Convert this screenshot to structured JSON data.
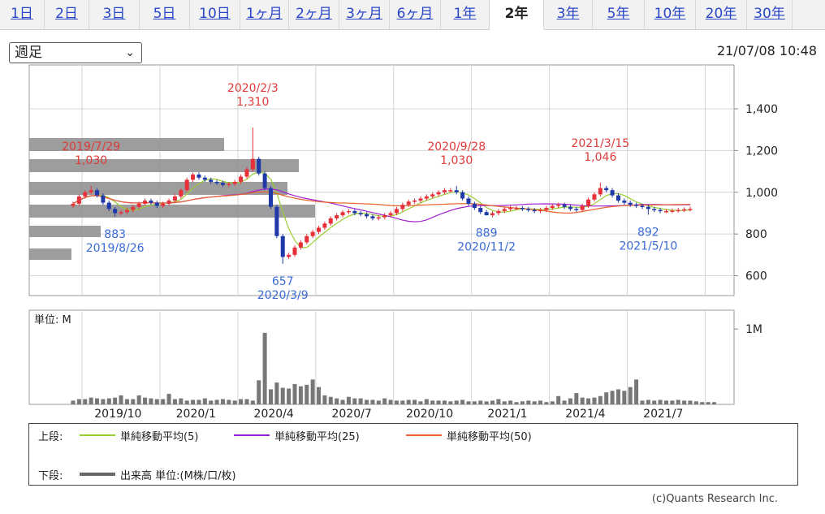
{
  "tabs": [
    {
      "label": "1日",
      "active": false
    },
    {
      "label": "2日",
      "active": false
    },
    {
      "label": "3日",
      "active": false
    },
    {
      "label": "5日",
      "active": false
    },
    {
      "label": "10日",
      "active": false
    },
    {
      "label": "1ヶ月",
      "active": false
    },
    {
      "label": "2ヶ月",
      "active": false
    },
    {
      "label": "3ヶ月",
      "active": false
    },
    {
      "label": "6ヶ月",
      "active": false
    },
    {
      "label": "1年",
      "active": false
    },
    {
      "label": "2年",
      "active": true
    },
    {
      "label": "3年",
      "active": false
    },
    {
      "label": "5年",
      "active": false
    },
    {
      "label": "10年",
      "active": false
    },
    {
      "label": "20年",
      "active": false
    },
    {
      "label": "30年",
      "active": false
    }
  ],
  "period_select": {
    "value": "週足"
  },
  "timestamp": "21/07/08 10:48",
  "chart_data": {
    "type": "candlestick",
    "price_axis": {
      "ticks": [
        600,
        800,
        1000,
        1200,
        1400
      ],
      "tick_labels": [
        "600",
        "800",
        "1,000",
        "1,200",
        "1,400"
      ],
      "ylim": [
        505,
        1610
      ]
    },
    "volume_axis": {
      "unit_label": "単位: M",
      "ticks": [
        1
      ],
      "tick_labels": [
        "1M"
      ],
      "ylim": [
        0,
        1.25
      ]
    },
    "x_ticks": [
      "2019/10",
      "2020/1",
      "2020/4",
      "2020/7",
      "2020/10",
      "2021/1",
      "2021/4",
      "2021/7"
    ],
    "annotations": [
      {
        "date": "2020/2/3",
        "value_label": "1,310",
        "kind": "high",
        "date_label": "2020/2/3",
        "value": 1310,
        "week": 30
      },
      {
        "date": "2019/7/29",
        "value_label": "1,030",
        "kind": "high",
        "date_label": "2019/7/29",
        "value": 1030,
        "week": 3
      },
      {
        "date": "2020/9/28",
        "value_label": "1,030",
        "kind": "high",
        "date_label": "2020/9/28",
        "value": 1030,
        "week": 64
      },
      {
        "date": "2021/3/15",
        "value_label": "1,046",
        "kind": "high",
        "date_label": "2021/3/15",
        "value": 1046,
        "week": 88
      },
      {
        "date": "2019/8/26",
        "value_label": "883",
        "kind": "low",
        "date_label": "2019/8/26",
        "value": 883,
        "week": 7
      },
      {
        "date": "2020/3/9",
        "value_label": "657",
        "kind": "low",
        "date_label": "2020/3/9",
        "value": 657,
        "week": 35
      },
      {
        "date": "2020/11/2",
        "value_label": "889",
        "kind": "low",
        "date_label": "2020/11/2",
        "value": 889,
        "week": 69
      },
      {
        "date": "2021/5/10",
        "value_label": "892",
        "kind": "low",
        "date_label": "2021/5/10",
        "value": 892,
        "week": 96
      }
    ],
    "volume_profile": [
      0.07,
      0.17,
      0.11,
      0.05
    ],
    "weeks": {
      "close": [
        945,
        980,
        1000,
        1010,
        985,
        950,
        920,
        900,
        905,
        915,
        930,
        945,
        960,
        950,
        935,
        945,
        960,
        980,
        1010,
        1060,
        1085,
        1070,
        1060,
        1050,
        1045,
        1035,
        1040,
        1050,
        1075,
        1110,
        1160,
        1090,
        1020,
        930,
        790,
        690,
        700,
        735,
        760,
        790,
        810,
        830,
        850,
        875,
        890,
        905,
        910,
        900,
        895,
        885,
        875,
        880,
        890,
        900,
        920,
        940,
        955,
        960,
        970,
        980,
        990,
        1000,
        1010,
        1010,
        1000,
        970,
        945,
        925,
        905,
        890,
        900,
        910,
        920,
        925,
        925,
        920,
        915,
        910,
        915,
        925,
        935,
        940,
        930,
        920,
        915,
        935,
        965,
        990,
        1020,
        1010,
        985,
        960,
        950,
        940,
        935,
        930,
        920,
        915,
        910,
        910,
        912,
        915,
        918,
        920
      ],
      "volume": [
        0.05,
        0.07,
        0.07,
        0.09,
        0.08,
        0.07,
        0.08,
        0.09,
        0.12,
        0.07,
        0.07,
        0.12,
        0.09,
        0.08,
        0.07,
        0.07,
        0.14,
        0.07,
        0.08,
        0.05,
        0.06,
        0.06,
        0.08,
        0.05,
        0.06,
        0.07,
        0.06,
        0.05,
        0.07,
        0.07,
        0.05,
        0.32,
        0.95,
        0.2,
        0.29,
        0.22,
        0.21,
        0.27,
        0.24,
        0.26,
        0.33,
        0.23,
        0.12,
        0.1,
        0.08,
        0.06,
        0.1,
        0.08,
        0.08,
        0.06,
        0.06,
        0.05,
        0.08,
        0.06,
        0.05,
        0.05,
        0.06,
        0.06,
        0.04,
        0.07,
        0.05,
        0.05,
        0.05,
        0.04,
        0.05,
        0.06,
        0.04,
        0.04,
        0.05,
        0.04,
        0.05,
        0.07,
        0.04,
        0.05,
        0.03,
        0.04,
        0.05,
        0.04,
        0.05,
        0.03,
        0.04,
        0.11,
        0.05,
        0.08,
        0.15,
        0.09,
        0.08,
        0.09,
        0.11,
        0.16,
        0.18,
        0.2,
        0.18,
        0.23,
        0.33,
        0.05,
        0.06,
        0.05,
        0.06,
        0.05,
        0.05,
        0.06,
        0.05,
        0.05,
        0.04,
        0.03,
        0.03,
        0.03
      ]
    }
  },
  "legend": {
    "upper_label": "上段:",
    "lower_label": "下段:",
    "items": [
      {
        "label": "単純移動平均(5)",
        "color": "#9acd32"
      },
      {
        "label": "単純移動平均(25)",
        "color": "#a020d0"
      },
      {
        "label": "単純移動平均(50)",
        "color": "#e8602a"
      }
    ],
    "volume_label": "出来高 単位:(M株/口/枚)",
    "volume_color": "#666666"
  },
  "credit": "(c)Quants Research Inc."
}
